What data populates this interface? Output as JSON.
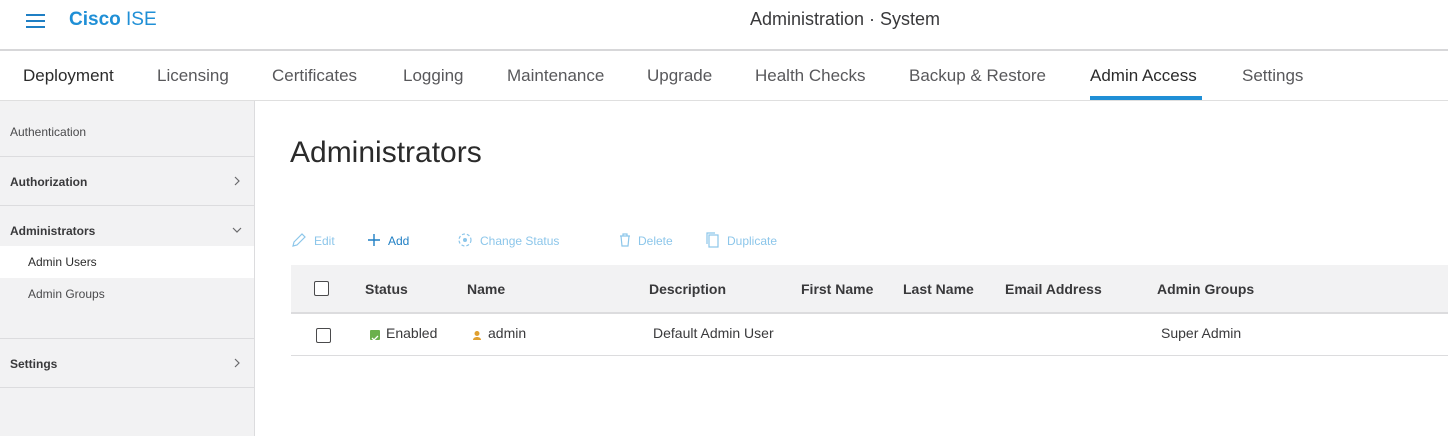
{
  "header": {
    "brand_bold": "Cisco",
    "brand_rest": "ISE",
    "context": "Administration · System"
  },
  "tabs": [
    {
      "label": "Deployment"
    },
    {
      "label": "Licensing"
    },
    {
      "label": "Certificates"
    },
    {
      "label": "Logging"
    },
    {
      "label": "Maintenance"
    },
    {
      "label": "Upgrade"
    },
    {
      "label": "Health Checks"
    },
    {
      "label": "Backup & Restore"
    },
    {
      "label": "Admin Access",
      "active": true
    },
    {
      "label": "Settings"
    }
  ],
  "sidebar": {
    "authentication": "Authentication",
    "authorization": "Authorization",
    "administrators": "Administrators",
    "admin_users": "Admin Users",
    "admin_groups": "Admin Groups",
    "settings": "Settings"
  },
  "main": {
    "title": "Administrators",
    "toolbar": {
      "edit": "Edit",
      "add": "Add",
      "change_status": "Change Status",
      "delete": "Delete",
      "duplicate": "Duplicate"
    },
    "columns": [
      "Status",
      "Name",
      "Description",
      "First Name",
      "Last Name",
      "Email Address",
      "Admin Groups"
    ],
    "rows": [
      {
        "status": "Enabled",
        "name": "admin",
        "description": "Default Admin User",
        "first_name": "",
        "last_name": "",
        "email": "",
        "admin_groups": "Super Admin"
      }
    ]
  },
  "colors": {
    "accent": "#1f8fd6",
    "enabled_status": "#6ab04c",
    "toolbar_disabled": "#8cc6ea"
  }
}
